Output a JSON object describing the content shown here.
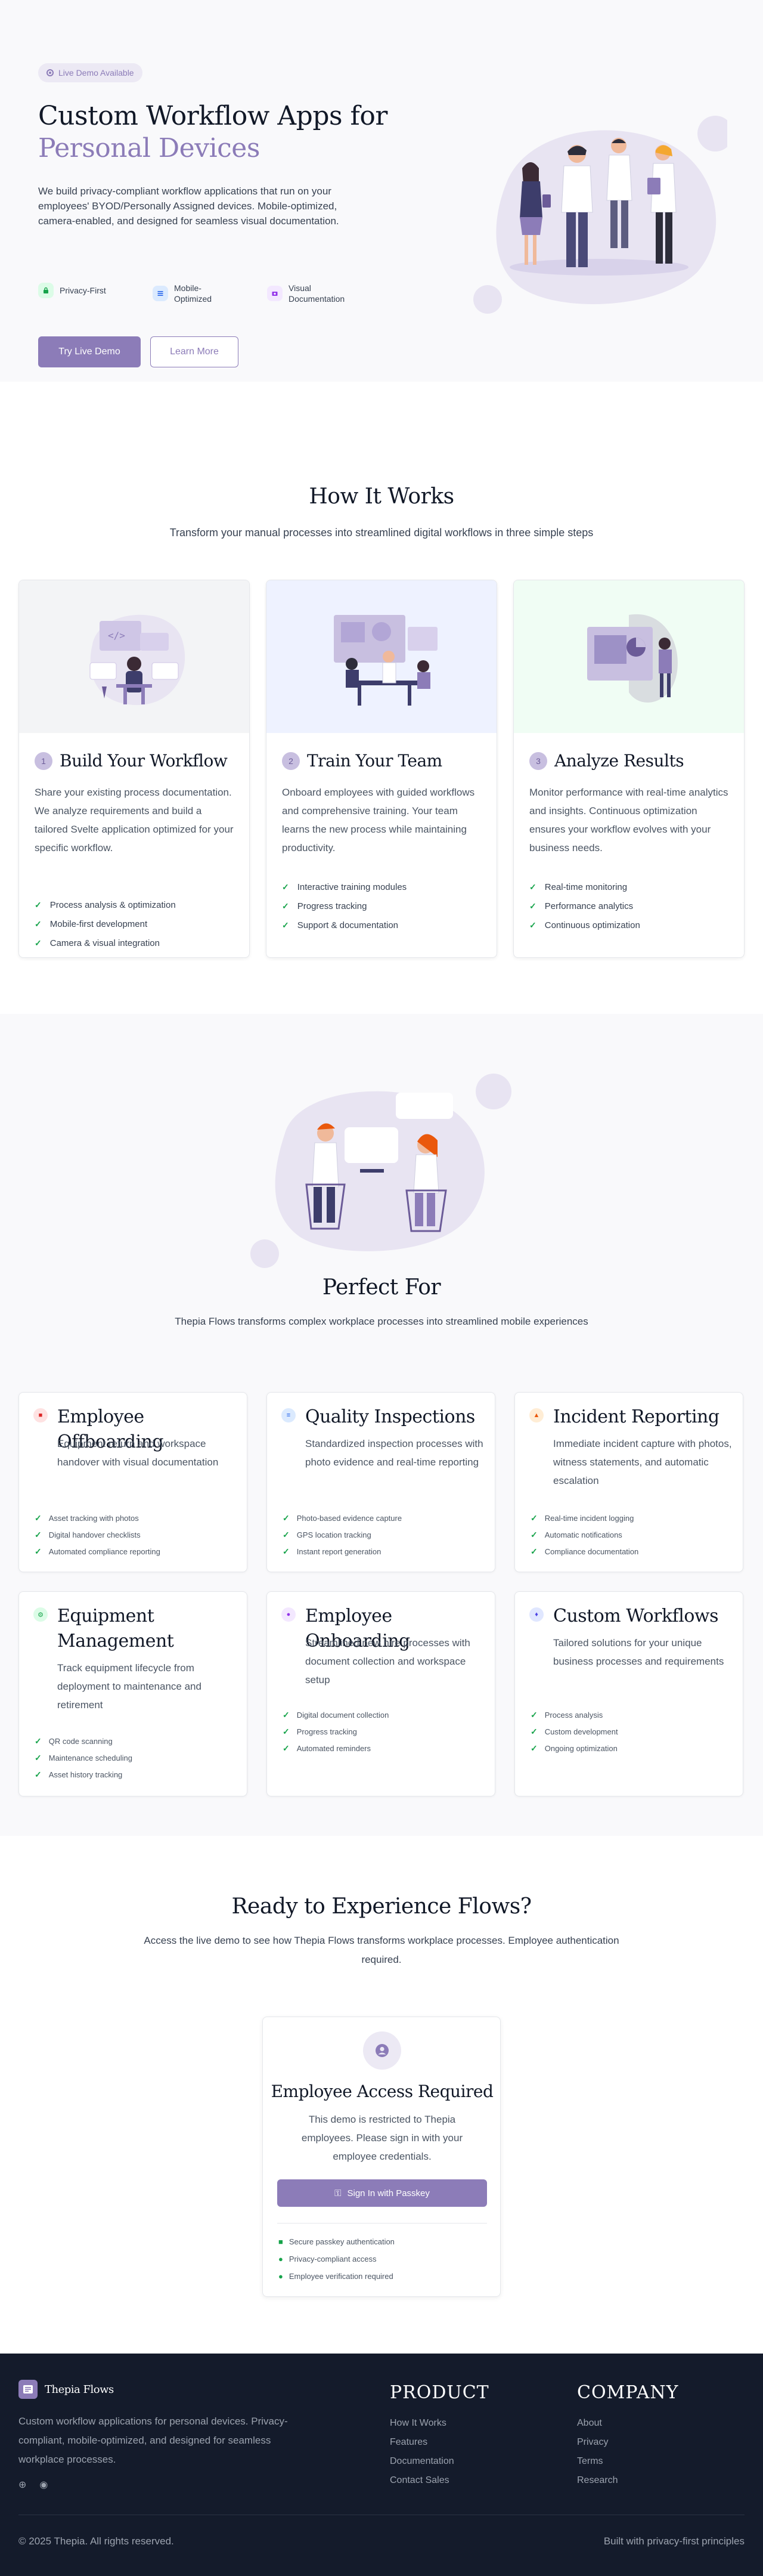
{
  "hero": {
    "badge": "Live Demo Available",
    "title_line1": "Custom Workflow Apps for",
    "title_line2": "Personal Devices",
    "lead": "We build privacy-compliant workflow applications that run on your employees' BYOD/Personally Assigned devices. Mobile-optimized, camera-enabled, and designed for seamless visual documentation.",
    "features": [
      {
        "label": "Privacy-First",
        "icon": "lock-icon",
        "color": "#16a34a",
        "bg": "#dcfce7"
      },
      {
        "label": "Mobile-Optimized",
        "icon": "mobile-icon",
        "color": "#2563eb",
        "bg": "#dbeafe"
      },
      {
        "label": "Visual Documentation",
        "icon": "camera-icon",
        "color": "#9333ea",
        "bg": "#f3e8ff"
      }
    ],
    "primary_cta": "Try Live Demo",
    "secondary_cta": "Learn More"
  },
  "toolbar": {
    "icons": [
      "hand-icon",
      "search-icon",
      "video-icon",
      "settings-icon"
    ]
  },
  "how": {
    "title": "How It Works",
    "subtitle": "Transform your manual processes into streamlined digital workflows in three simple steps",
    "steps": [
      {
        "num": "1",
        "title": "Build Your Workflow",
        "desc": "Share your existing process documentation. We analyze requirements and build a tailored Svelte application optimized for your specific workflow.",
        "items": [
          "Process analysis & optimization",
          "Mobile-first development",
          "Camera & visual integration"
        ],
        "bg": "#f3f4f6"
      },
      {
        "num": "2",
        "title": "Train Your Team",
        "desc": "Onboard employees with guided workflows and comprehensive training. Your team learns the new process while maintaining productivity.",
        "items": [
          "Interactive training modules",
          "Progress tracking",
          "Support & documentation"
        ],
        "bg": "#eef2ff"
      },
      {
        "num": "3",
        "title": "Analyze Results",
        "desc": "Monitor performance with real-time analytics and insights. Continuous optimization ensures your workflow evolves with your business needs.",
        "items": [
          "Real-time monitoring",
          "Performance analytics",
          "Continuous optimization"
        ],
        "bg": "#f0fdf4"
      }
    ]
  },
  "perfect": {
    "title": "Perfect For",
    "subtitle": "Thepia Flows transforms complex workplace processes into streamlined mobile experiences",
    "cases": [
      {
        "title": "Employee Offboarding",
        "icon": "briefcase-icon",
        "color": "#dc2626",
        "bg": "#fee2e2",
        "desc": "Equipment return and workspace handover with visual documentation",
        "items": [
          "Asset tracking with photos",
          "Digital handover checklists",
          "Automated compliance reporting"
        ]
      },
      {
        "title": "Quality Inspections",
        "icon": "checklist-icon",
        "color": "#2563eb",
        "bg": "#dbeafe",
        "desc": "Standardized inspection processes with photo evidence and real-time reporting",
        "items": [
          "Photo-based evidence capture",
          "GPS location tracking",
          "Instant report generation"
        ]
      },
      {
        "title": "Incident Reporting",
        "icon": "warning-icon",
        "color": "#ea580c",
        "bg": "#ffedd5",
        "desc": "Immediate incident capture with photos, witness statements, and automatic escalation",
        "items": [
          "Real-time incident logging",
          "Automatic notifications",
          "Compliance documentation"
        ]
      },
      {
        "title": "Equipment Management",
        "icon": "gear-icon",
        "color": "#16a34a",
        "bg": "#dcfce7",
        "desc": "Track equipment lifecycle from deployment to maintenance and retirement",
        "items": [
          "QR code scanning",
          "Maintenance scheduling",
          "Asset history tracking"
        ]
      },
      {
        "title": "Employee Onboarding",
        "icon": "users-icon",
        "color": "#9333ea",
        "bg": "#f3e8ff",
        "desc": "Streamlined new hire processes with document collection and workspace setup",
        "items": [
          "Digital document collection",
          "Progress tracking",
          "Automated reminders"
        ]
      },
      {
        "title": "Custom Workflows",
        "icon": "flame-icon",
        "color": "#4f46e5",
        "bg": "#e0e7ff",
        "desc": "Tailored solutions for your unique business processes and requirements",
        "items": [
          "Process analysis",
          "Custom development",
          "Ongoing optimization"
        ]
      }
    ]
  },
  "ready": {
    "title": "Ready to Experience Flows?",
    "subtitle": "Access the live demo to see how Thepia Flows transforms workplace processes. Employee authentication required.",
    "card": {
      "icon": "user-icon",
      "title": "Employee Access Required",
      "desc": "This demo is restricted to Thepia employees. Please sign in with your employee credentials.",
      "button": "Sign In with Passkey",
      "items": [
        "Secure passkey authentication",
        "Privacy-compliant access",
        "Employee verification required"
      ]
    }
  },
  "footer": {
    "brand": "Thepia Flows",
    "desc": "Custom workflow applications for personal devices. Privacy-compliant, mobile-optimized, and designed for seamless workplace processes.",
    "product_heading": "PRODUCT",
    "product_links": [
      "How It Works",
      "Features",
      "Documentation",
      "Contact Sales"
    ],
    "company_heading": "COMPANY",
    "company_links": [
      "About",
      "Privacy",
      "Terms",
      "Research"
    ],
    "copyright": "© 2025 Thepia. All rights reserved.",
    "tagline": "Built with privacy-first principles"
  }
}
